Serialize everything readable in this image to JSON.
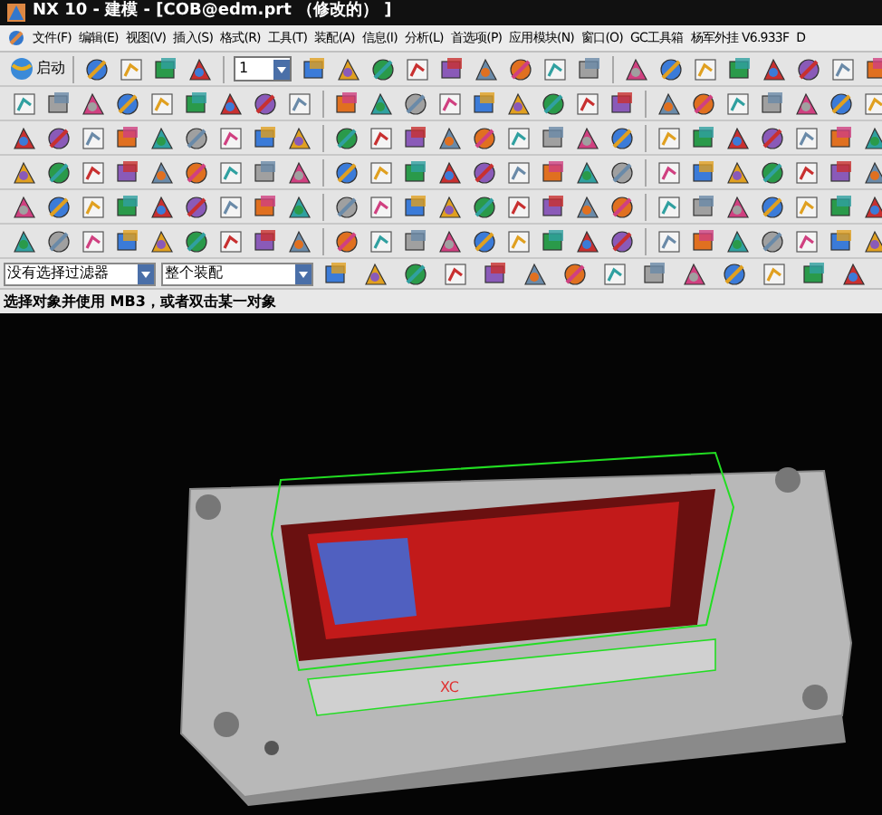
{
  "window": {
    "title": "NX 10 - 建模 - [COB@edm.prt （修改的） ]"
  },
  "menu": [
    "文件(F)",
    "编辑(E)",
    "视图(V)",
    "插入(S)",
    "格式(R)",
    "工具(T)",
    "装配(A)",
    "信息(I)",
    "分析(L)",
    "首选项(P)",
    "应用模块(N)",
    "窗口(O)",
    "GC工具箱",
    "杨军外挂 V6.933F",
    "D"
  ],
  "start_button": {
    "label": "启动"
  },
  "layer_dropdown": {
    "value": "1"
  },
  "selection_bar": {
    "filter": "没有选择过滤器",
    "scope": "整个装配"
  },
  "status_bar": {
    "prompt": "选择对象并使用 MB3，或者双击某一对象"
  },
  "viewport": {
    "axis_label": "XC"
  }
}
